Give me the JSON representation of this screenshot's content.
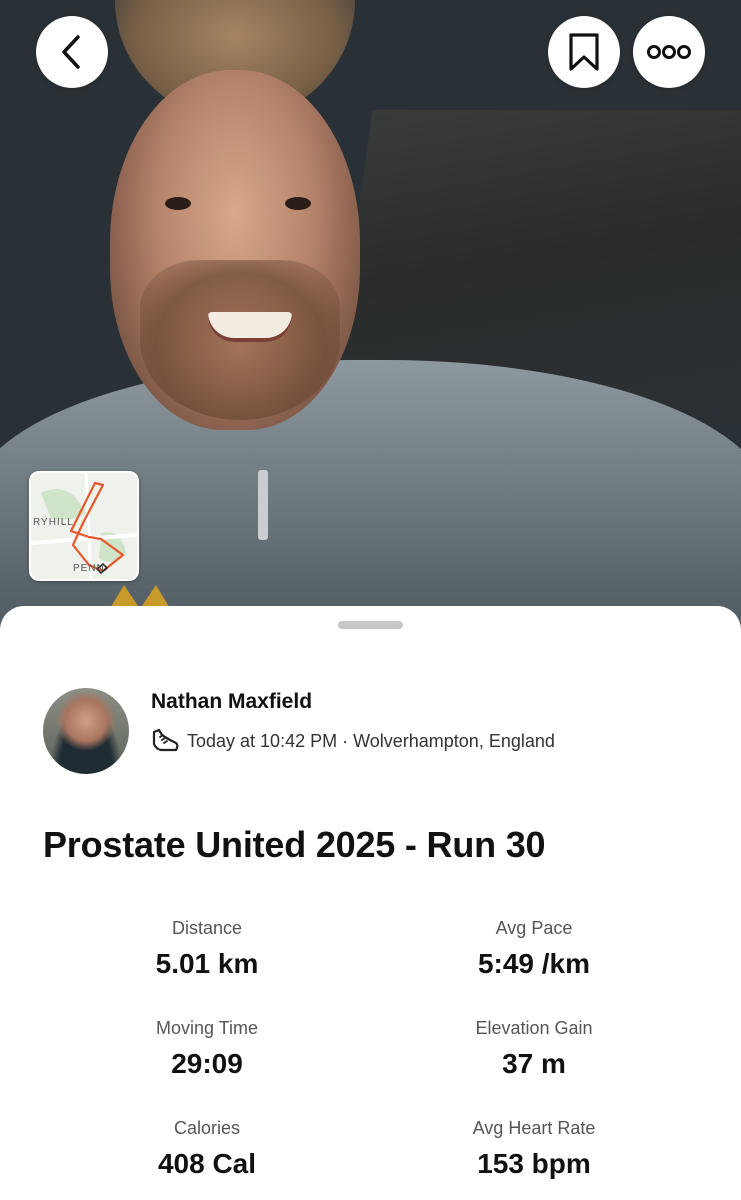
{
  "header": {
    "back_icon": "chevron-left-icon",
    "bookmark_icon": "bookmark-icon",
    "more_icon": "more-dots-icon"
  },
  "map_thumbnail": {
    "label_top": "RYHILL",
    "label_bottom": "PENN",
    "route_color": "#e8572a"
  },
  "athlete": {
    "name": "Nathan Maxfield",
    "activity_icon": "run-shoe-icon",
    "meta": "Today at 10:42 PM · Wolverhampton, England"
  },
  "activity": {
    "title": "Prostate United 2025 - Run 30"
  },
  "stats": [
    {
      "label": "Distance",
      "value": "5.01 km"
    },
    {
      "label": "Avg Pace",
      "value": "5:49 /km"
    },
    {
      "label": "Moving Time",
      "value": "29:09"
    },
    {
      "label": "Elevation Gain",
      "value": "37 m"
    },
    {
      "label": "Calories",
      "value": "408 Cal"
    },
    {
      "label": "Avg Heart Rate",
      "value": "153 bpm"
    }
  ],
  "colors": {
    "accent": "#fc4c02",
    "sheet_background": "#ffffff",
    "text_primary": "#111111",
    "text_secondary": "#555555"
  }
}
